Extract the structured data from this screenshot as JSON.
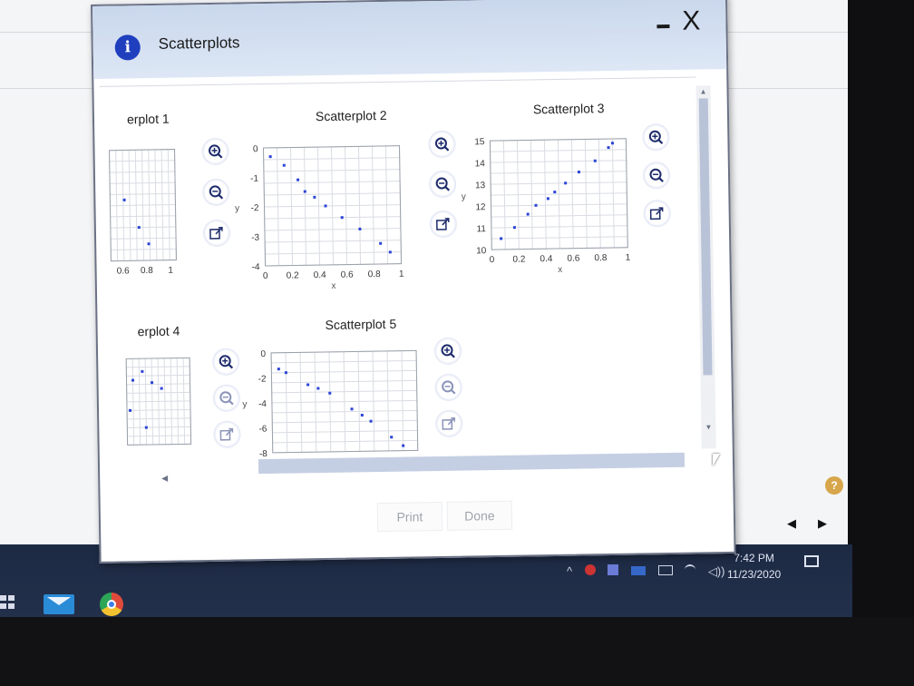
{
  "dialog": {
    "title": "Scatterplots",
    "info_glyph": "i",
    "minimize_glyph": "-",
    "close_glyph": "X",
    "print_label": "Print",
    "done_label": "Done"
  },
  "plots": [
    {
      "title": "erplot 1"
    },
    {
      "title": "Scatterplot 2"
    },
    {
      "title": "Scatterplot 3"
    },
    {
      "title": "erplot 4"
    },
    {
      "title": "Scatterplot 5"
    }
  ],
  "chart_data": [
    {
      "type": "scatter",
      "title": "erplot 1",
      "xticks": [
        "0.6",
        "0.8",
        "1"
      ],
      "x": [
        0.62,
        0.74,
        0.82
      ],
      "y": [
        0.55,
        0.3,
        0.15
      ]
    },
    {
      "type": "scatter",
      "title": "Scatterplot 2",
      "xlabel": "x",
      "ylabel": "y",
      "xlim": [
        0,
        1
      ],
      "ylim": [
        -4,
        0
      ],
      "xticks": [
        "0",
        "0.2",
        "0.4",
        "0.6",
        "0.8",
        "1"
      ],
      "yticks": [
        "0",
        "-1",
        "-2",
        "-3",
        "-4"
      ],
      "x": [
        0.05,
        0.15,
        0.25,
        0.3,
        0.37,
        0.45,
        0.57,
        0.7,
        0.85,
        0.92
      ],
      "y": [
        -0.3,
        -0.6,
        -1.1,
        -1.5,
        -1.7,
        -2.0,
        -2.4,
        -2.8,
        -3.3,
        -3.6
      ]
    },
    {
      "type": "scatter",
      "title": "Scatterplot 3",
      "xlabel": "x",
      "ylabel": "y",
      "xlim": [
        0,
        1
      ],
      "ylim": [
        10,
        15
      ],
      "xticks": [
        "0",
        "0.2",
        "0.4",
        "0.6",
        "0.8",
        "1"
      ],
      "yticks": [
        "10",
        "11",
        "12",
        "13",
        "14",
        "15"
      ],
      "x": [
        0.07,
        0.17,
        0.27,
        0.33,
        0.42,
        0.47,
        0.55,
        0.65,
        0.77,
        0.87,
        0.9
      ],
      "y": [
        10.5,
        11.0,
        11.6,
        12.0,
        12.3,
        12.6,
        13.0,
        13.5,
        14.0,
        14.6,
        14.8
      ]
    },
    {
      "type": "scatter",
      "title": "erplot 4",
      "x": [
        0.1,
        0.25,
        0.4,
        0.55,
        0.05,
        0.3
      ],
      "y": [
        0.75,
        0.85,
        0.72,
        0.65,
        0.4,
        0.2
      ]
    },
    {
      "type": "scatter",
      "title": "Scatterplot 5",
      "ylabel": "y",
      "ylim": [
        -8,
        0
      ],
      "yticks": [
        "0",
        "-2",
        "-4",
        "-6",
        "-8"
      ],
      "x": [
        0.05,
        0.1,
        0.25,
        0.32,
        0.4,
        0.55,
        0.62,
        0.68,
        0.82,
        0.9
      ],
      "y": [
        -1.3,
        -1.6,
        -2.6,
        -2.9,
        -3.3,
        -4.6,
        -5.1,
        -5.6,
        -6.9,
        -7.6
      ]
    }
  ],
  "taskbar": {
    "time": "7:42 PM",
    "date": "11/23/2020",
    "tray_caret": "^",
    "tray_volume": "◁))"
  },
  "outside": {
    "help_glyph": "?",
    "nav_left": "◀",
    "nav_right": "▶"
  }
}
